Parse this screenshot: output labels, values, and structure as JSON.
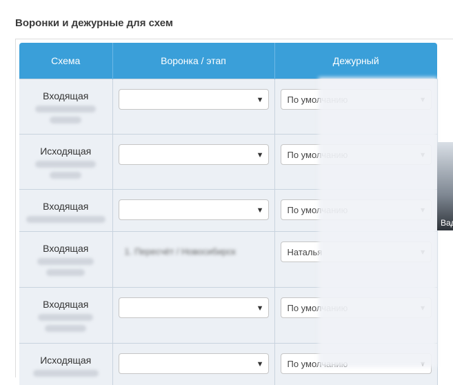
{
  "section_title": "Воронки и дежурные для схем",
  "table": {
    "headers": [
      "Схема",
      "Воронка / этап",
      "Дежурный"
    ],
    "rows": [
      {
        "scheme": "Входящая",
        "funnel": "",
        "duty": "По умолчанию"
      },
      {
        "scheme": "Исходящая",
        "funnel": "",
        "duty": "По умолчанию"
      },
      {
        "scheme": "Входящая",
        "funnel": "",
        "duty": "По умолчанию"
      },
      {
        "scheme": "Входящая",
        "funnel": "1. Пересчёт / Новосибирск",
        "duty": "Наталья"
      },
      {
        "scheme": "Входящая",
        "funnel": "",
        "duty": "По умолчанию"
      },
      {
        "scheme": "Исходящая",
        "funnel": "",
        "duty": "По умолчанию"
      }
    ]
  },
  "video_label": "Вад"
}
